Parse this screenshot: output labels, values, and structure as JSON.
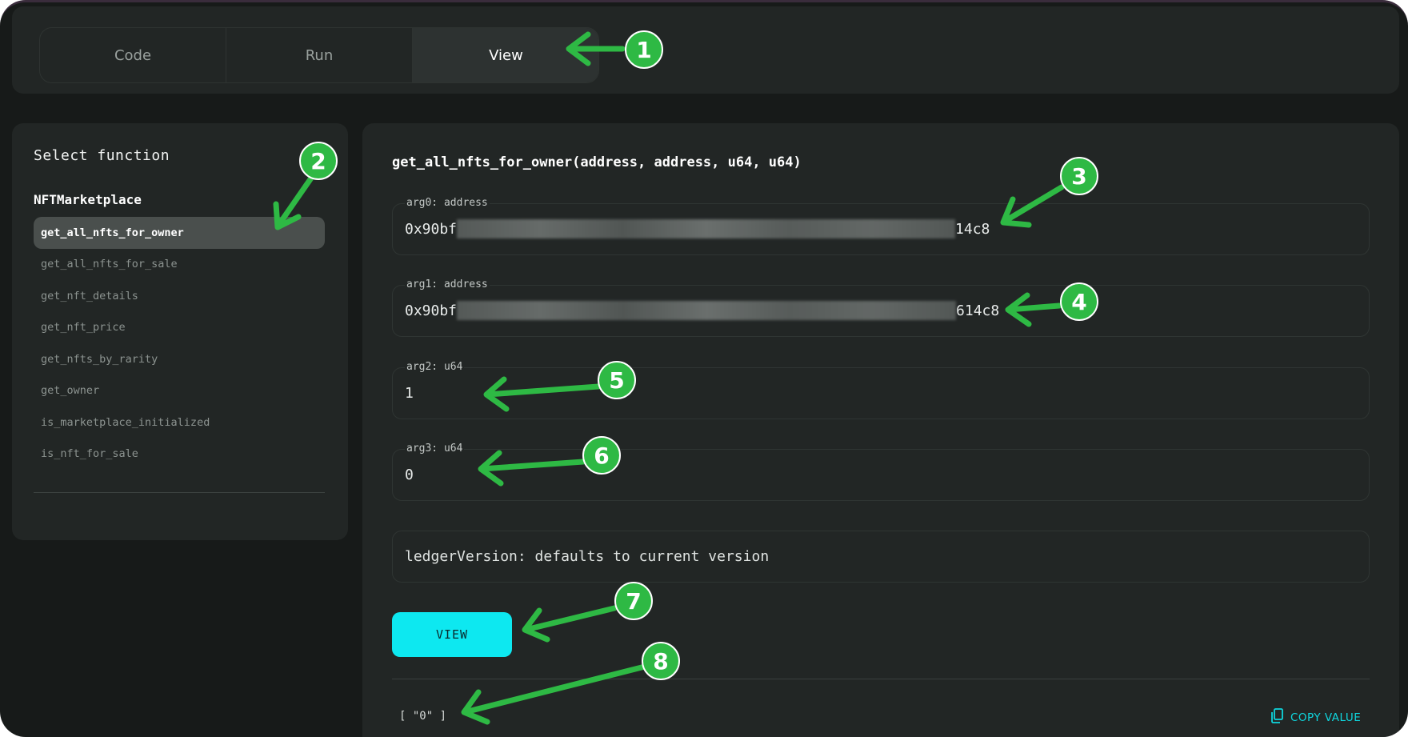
{
  "tabs": [
    {
      "label": "Code",
      "active": false
    },
    {
      "label": "Run",
      "active": false
    },
    {
      "label": "View",
      "active": true
    }
  ],
  "sidebar": {
    "heading": "Select function",
    "module": "NFTMarketplace",
    "functions": [
      "get_all_nfts_for_owner",
      "get_all_nfts_for_sale",
      "get_nft_details",
      "get_nft_price",
      "get_nfts_by_rarity",
      "get_owner",
      "is_marketplace_initialized",
      "is_nft_for_sale"
    ],
    "selected": "get_all_nfts_for_owner"
  },
  "main": {
    "signature": "get_all_nfts_for_owner(address, address, u64, u64)",
    "args": [
      {
        "label": "arg0: address",
        "prefix": "0x90bf",
        "suffix": "14c8",
        "redacted": true
      },
      {
        "label": "arg1: address",
        "prefix": "0x90bf",
        "suffix": "614c8",
        "redacted": true
      },
      {
        "label": "arg2: u64",
        "value": "1"
      },
      {
        "label": "arg3: u64",
        "value": "0"
      }
    ],
    "ledger_placeholder": "ledgerVersion: defaults to current version",
    "view_button": "VIEW",
    "result": "[ \"0\" ]",
    "copy_label": "COPY VALUE"
  },
  "annotations": [
    "1",
    "2",
    "3",
    "4",
    "5",
    "6",
    "7",
    "8"
  ],
  "colors": {
    "accent": "#0de8f0",
    "annotation": "#2eb944",
    "background": "#171a19",
    "panel": "#222625"
  },
  "icons": {
    "copy": "copy-icon"
  }
}
